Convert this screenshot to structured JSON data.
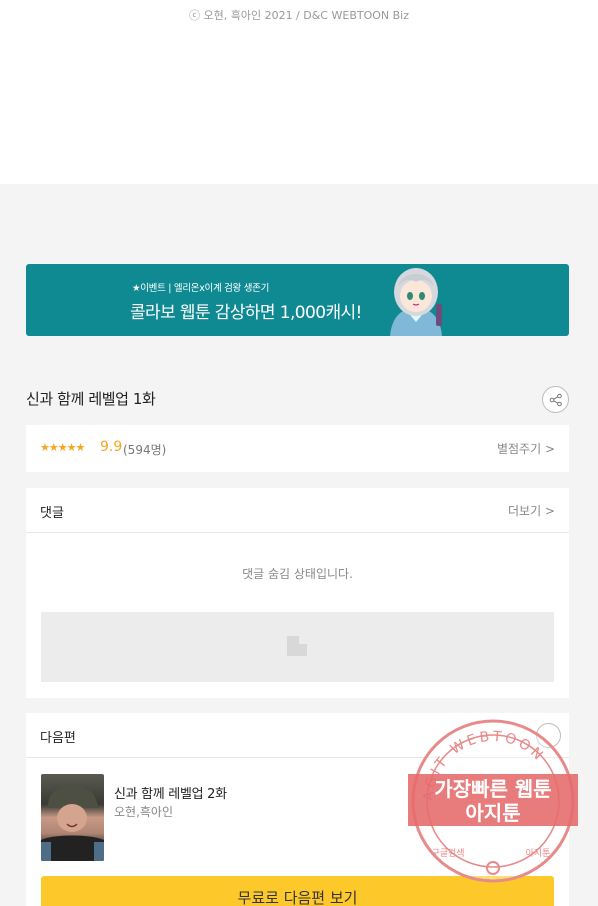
{
  "copyright": "ⓒ 오현, 흑아인 2021 / D&C WEBTOON Biz",
  "banner": {
    "small_text": "★이벤트 | 엘리온x이계 검왕 생존기",
    "big_text": "콜라보 웹툰 감상하면 1,000캐시!"
  },
  "episode": {
    "title": "신과 함께 레벨업 1화"
  },
  "rating": {
    "stars": "★★★★★",
    "score": "9.9",
    "count": "(594명)",
    "rate_link": "별점주기 >"
  },
  "comments": {
    "title": "댓글",
    "more": "더보기 >",
    "hidden_msg": "댓글 숨김 상태입니다."
  },
  "next": {
    "title": "다음편",
    "episode_title": "신과 함께 레벨업 2화",
    "author": "오현,흑아인",
    "button": "무료로 다음편 보기"
  },
  "watermark": {
    "ring_text": "AGIT WEBTOON",
    "line1": "가장빠른 웹툰",
    "line2": "아지툰",
    "bottom_left": "구글검색",
    "bottom_right": "아지툰"
  },
  "colors": {
    "accent": "#fdc92a",
    "banner": "#0f8a93",
    "star": "#f5a623"
  }
}
